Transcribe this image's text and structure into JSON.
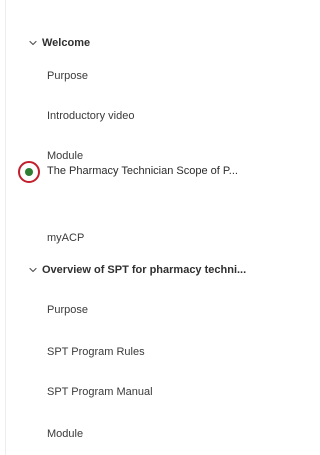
{
  "colors": {
    "current_dot": "#2e7d32",
    "highlight_ring": "#c21f2e"
  },
  "sections": [
    {
      "title": "Welcome",
      "expanded": true,
      "toggle_icon": "chevron-down-icon",
      "items": [
        {
          "label": "Purpose"
        },
        {
          "label": "Introductory video"
        },
        {
          "label": "Module"
        },
        {
          "label": "The Pharmacy Technician Scope of P...",
          "current": true,
          "status_icon": "current-item-dot-icon"
        },
        {
          "label": "myACP"
        }
      ]
    },
    {
      "title": "Overview of SPT for pharmacy techni...",
      "expanded": true,
      "toggle_icon": "chevron-down-icon",
      "items": [
        {
          "label": "Purpose"
        },
        {
          "label": "SPT Program Rules"
        },
        {
          "label": "SPT Program Manual"
        },
        {
          "label": "Module"
        }
      ]
    }
  ]
}
